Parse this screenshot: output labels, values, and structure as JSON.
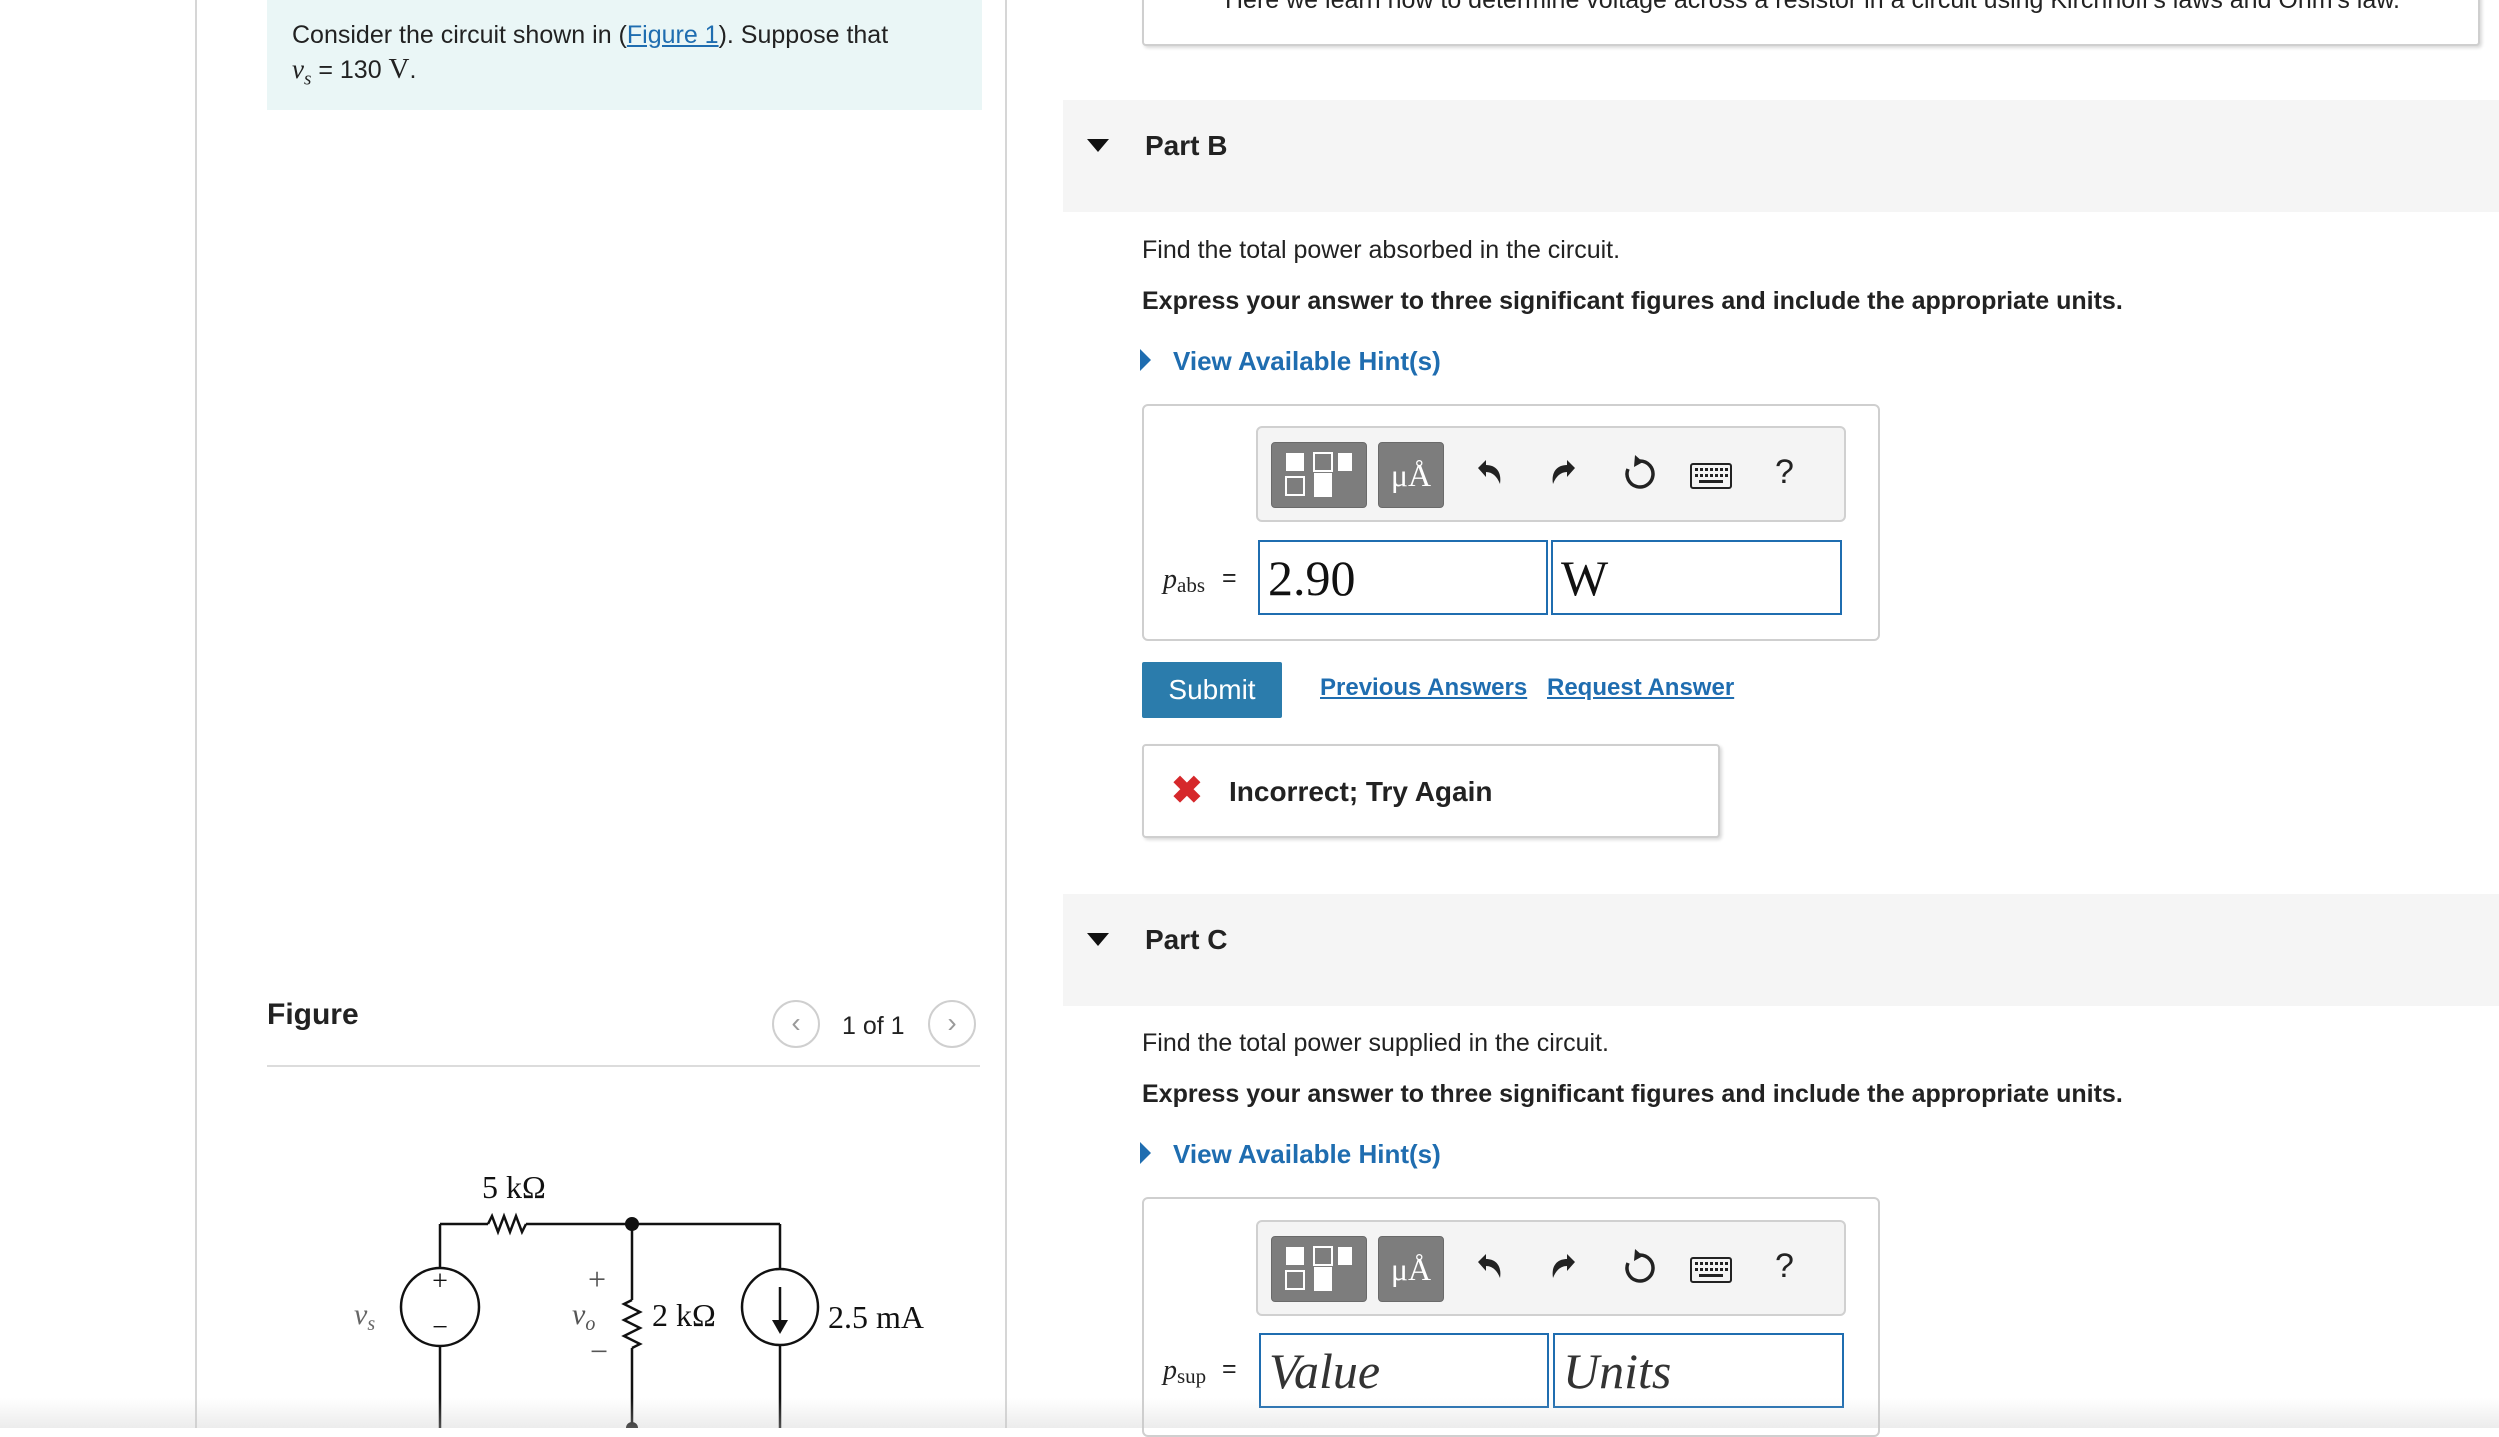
{
  "problem": {
    "text_before": "Consider the circuit shown in (",
    "figure_link": "Figure 1",
    "text_after": "). Suppose that",
    "vs_symbol": "v",
    "vs_sub": "s",
    "vs_eq": " = 130 ",
    "vs_unit": "V",
    "vs_period": "."
  },
  "figure": {
    "title": "Figure",
    "counter": "1 of 1",
    "prev_icon": "chevron-left-icon",
    "next_icon": "chevron-right-icon",
    "circuit": {
      "r1_label": "5 kΩ",
      "r2_label": "2 kΩ",
      "source_label": "v",
      "source_sub": "s",
      "current_label": "2.5 mA",
      "vo_label": "v",
      "vo_sub": "o",
      "plus": "+",
      "minus": "−"
    }
  },
  "intro": {
    "text": "Here we learn how to determine voltage across a resistor in a circuit using Kirchhoff's laws and Ohm's law."
  },
  "part_b": {
    "title": "Part B",
    "question": "Find the total power absorbed in the circuit.",
    "instruction": "Express your answer to three significant figures and include the appropriate units.",
    "hint_label": "View Available Hint(s)",
    "var_symbol": "p",
    "var_sub": "abs",
    "equals": "=",
    "value": "2.90",
    "units": "W",
    "submit_label": "Submit",
    "previous_answers": "Previous Answers",
    "request_answer": "Request Answer",
    "feedback_icon": "✖",
    "feedback": "Incorrect; Try Again"
  },
  "part_c": {
    "title": "Part C",
    "question": "Find the total power supplied in the circuit.",
    "instruction": "Express your answer to three significant figures and include the appropriate units.",
    "hint_label": "View Available Hint(s)",
    "var_symbol": "p",
    "var_sub": "sup",
    "equals": "=",
    "value_placeholder": "Value",
    "units_placeholder": "Units"
  },
  "toolbar": {
    "mu_label": "μÅ",
    "help_label": "?",
    "icons": [
      "templates-icon",
      "units-icon",
      "undo-icon",
      "redo-icon",
      "reset-icon",
      "keyboard-icon",
      "help-icon"
    ]
  },
  "colors": {
    "accent_blue": "#1f6db0",
    "submit_blue": "#2b7cac",
    "error_red": "#d6282b",
    "problem_bg": "#eaf6f6"
  }
}
